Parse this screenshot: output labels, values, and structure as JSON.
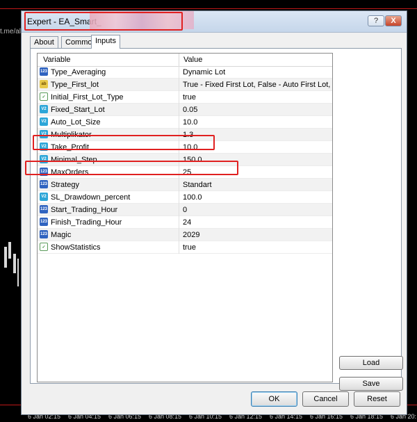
{
  "background": {
    "left_text": "t.me/al",
    "time_labels": [
      "6 Jan 02:15",
      "6 Jan 04:15",
      "6 Jan 06:15",
      "6 Jan 08:15",
      "6 Jan 10:15",
      "6 Jan 12:15",
      "6 Jan 14:15",
      "6 Jan 16:15",
      "6 Jan 18:15",
      "6 Jan 20:"
    ]
  },
  "window": {
    "title": "Expert - EA_Smart_",
    "help_label": "?",
    "close_label": "X"
  },
  "tabs": [
    {
      "label": "About",
      "active": false
    },
    {
      "label": "Common",
      "active": false
    },
    {
      "label": "Inputs",
      "active": true
    }
  ],
  "grid": {
    "headers": {
      "variable": "Variable",
      "value": "Value"
    },
    "rows": [
      {
        "icon": "int-type-icon",
        "badge": "123",
        "variable": "Type_Averaging",
        "value": "Dynamic Lot"
      },
      {
        "icon": "string-type-icon",
        "badge": "ab",
        "variable": "Type_First_lot",
        "value": "True - Fixed First Lot, False - Auto First Lot,"
      },
      {
        "icon": "bool-type-icon",
        "badge": "✓",
        "variable": "Initial_First_Lot_Type",
        "value": "true"
      },
      {
        "icon": "double-type-icon",
        "badge": "V2",
        "variable": "Fixed_Start_Lot",
        "value": "0.05"
      },
      {
        "icon": "double-type-icon",
        "badge": "V2",
        "variable": "Auto_Lot_Size",
        "value": "10.0"
      },
      {
        "icon": "double-type-icon",
        "badge": "V2",
        "variable": "Multiplikator",
        "value": "1.3"
      },
      {
        "icon": "double-type-icon",
        "badge": "V2",
        "variable": "Take_Profit",
        "value": "10.0"
      },
      {
        "icon": "double-type-icon",
        "badge": "V2",
        "variable": "Minimal_Step",
        "value": "150.0"
      },
      {
        "icon": "int-type-icon",
        "badge": "123",
        "variable": "MaxOrders",
        "value": "25"
      },
      {
        "icon": "enum-type-icon",
        "badge": "123",
        "variable": "Strategy",
        "value": "Standart"
      },
      {
        "icon": "double-type-icon",
        "badge": "V2",
        "variable": "SL_Drawdown_percent",
        "value": "100.0"
      },
      {
        "icon": "int-type-icon",
        "badge": "123",
        "variable": "Start_Trading_Hour",
        "value": "0"
      },
      {
        "icon": "int-type-icon",
        "badge": "123",
        "variable": "Finish_Trading_Hour",
        "value": "24"
      },
      {
        "icon": "int-type-icon",
        "badge": "123",
        "variable": "Magic",
        "value": "2029"
      },
      {
        "icon": "bool-type-icon",
        "badge": "✓",
        "variable": "ShowStatistics",
        "value": "true"
      }
    ]
  },
  "buttons": {
    "load": "Load",
    "save": "Save",
    "ok": "OK",
    "cancel": "Cancel",
    "reset": "Reset"
  },
  "colors": {
    "highlight": "#e02020"
  }
}
